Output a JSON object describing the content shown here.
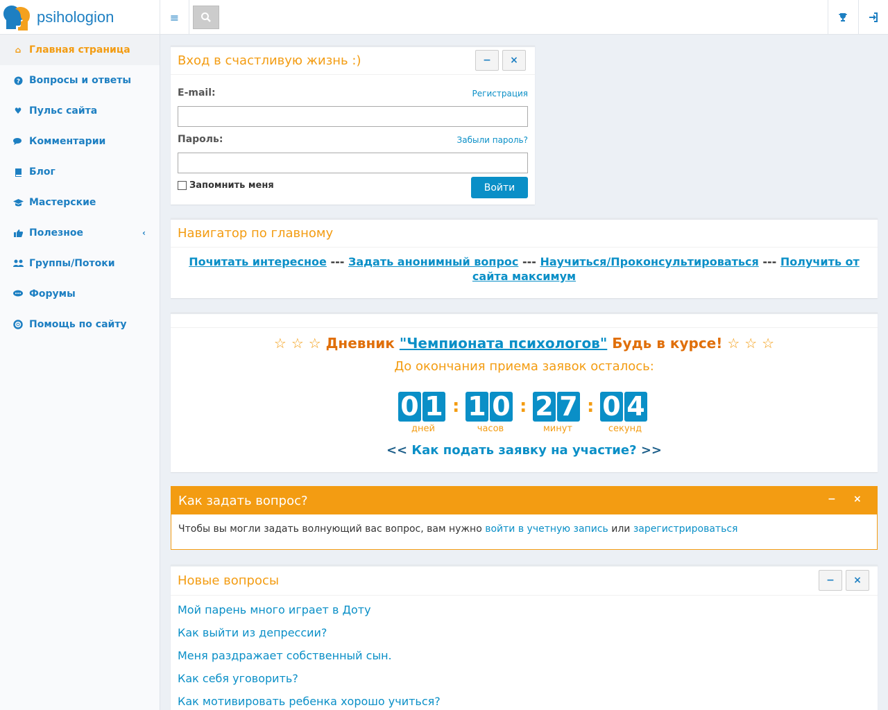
{
  "brand": {
    "name": "psihologion"
  },
  "sidebar": {
    "items": [
      {
        "label": "Главная страница",
        "icon": "home-icon"
      },
      {
        "label": "Вопросы и ответы",
        "icon": "question-circle-icon"
      },
      {
        "label": "Пульс сайта",
        "icon": "heartbeat-icon"
      },
      {
        "label": "Комментарии",
        "icon": "comments-icon"
      },
      {
        "label": "Блог",
        "icon": "book-icon"
      },
      {
        "label": "Мастерские",
        "icon": "graduation-cap-icon"
      },
      {
        "label": "Полезное",
        "icon": "thumbs-up-icon"
      },
      {
        "label": "Группы/Потоки",
        "icon": "users-icon"
      },
      {
        "label": "Форумы",
        "icon": "comment-icon"
      },
      {
        "label": "Помощь по сайту",
        "icon": "life-ring-icon"
      }
    ]
  },
  "login": {
    "title": "Вход в счастливую жизнь :)",
    "email_label": "E-mail:",
    "register_link": "Регистрация",
    "password_label": "Пароль:",
    "forgot_link": "Забыли пароль?",
    "remember_label": "Запомнить меня",
    "submit_label": "Войти"
  },
  "navigator": {
    "title": "Навигатор по главному",
    "links": [
      "Почитать интересное",
      "Задать анонимный вопрос",
      "Научиться/Проконсультироваться",
      "Получить от сайта максимум"
    ],
    "separator": "---"
  },
  "championship": {
    "stars": "☆ ☆ ☆",
    "prefix": "Дневник",
    "link": "\"Чемпионата психологов\"",
    "suffix": "Будь в курсе!",
    "subtitle": "До окончания приема заявок осталось:",
    "countdown": {
      "days": [
        "0",
        "1"
      ],
      "hours": [
        "1",
        "0"
      ],
      "minutes": [
        "2",
        "7"
      ],
      "seconds": [
        "0",
        "4"
      ],
      "labels": {
        "days": "дней",
        "hours": "часов",
        "minutes": "минут",
        "seconds": "секунд"
      },
      "colon": ":"
    },
    "apply_left": "<<",
    "apply_link": "Как подать заявку на участие?",
    "apply_right": ">>"
  },
  "how_to_ask": {
    "title": "Как задать вопрос?",
    "text_before": "Чтобы вы могли задать волнующий вас вопрос, вам нужно",
    "login_link": "войти в учетную запись",
    "text_or": "или",
    "register_link": "зарегистрироваться"
  },
  "new_questions": {
    "title": "Новые вопросы",
    "items": [
      "Мой парень много играет в Доту",
      "Как выйти из депрессии?",
      "Меня раздражает собственный сын.",
      "Как себя уговорить?",
      "Как мотивировать ребенка хорошо учиться?"
    ]
  },
  "colors": {
    "accent": "#f39c12",
    "link": "#0a8fc7",
    "brand": "#1d7fc2"
  }
}
